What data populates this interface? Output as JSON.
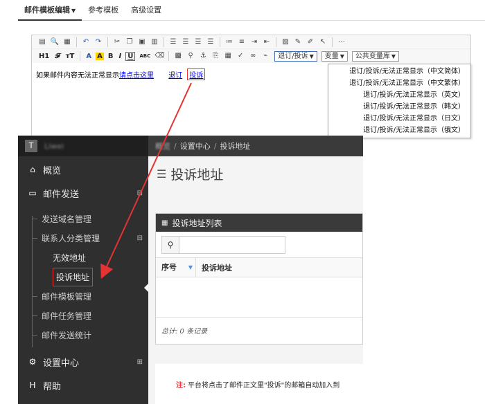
{
  "tabs": [
    {
      "label": "邮件模板编辑",
      "active": true
    },
    {
      "label": "参考模板",
      "active": false
    },
    {
      "label": "高级设置",
      "active": false
    }
  ],
  "toolbar": {
    "row2_text": [
      "H1",
      "𝓕",
      "тT",
      "A",
      "A",
      "B",
      "I",
      "U",
      "ABC"
    ],
    "drop_unsub": "退订/投诉",
    "drop_vars": "变量",
    "drop_public": "公共变量库"
  },
  "editor": {
    "text": "如果邮件内容无法正常显示",
    "link_view": "请点击这里",
    "link_unsub": "退订",
    "link_complain": "投诉"
  },
  "dropdown_items": [
    "退订/投诉/无法正常显示（中文简体）",
    "退订/投诉/无法正常显示（中文繁体）",
    "退订/投诉/无法正常显示（英文）",
    "退订/投诉/无法正常显示（韩文）",
    "退订/投诉/无法正常显示（日文）",
    "退订/投诉/无法正常显示（俄文）"
  ],
  "sidebar": {
    "brand": "Liwei",
    "overview": "概览",
    "mail_send": "邮件发送",
    "domain_mgmt": "发送域名管理",
    "contact_cat": "联系人分类管理",
    "invalid_addr": "无效地址",
    "complaint_addr": "投诉地址",
    "template_mgmt": "邮件模板管理",
    "task_mgmt": "邮件任务管理",
    "send_stats": "邮件发送统计",
    "settings": "设置中心",
    "help": "帮助"
  },
  "breadcrumb": {
    "home": "概览",
    "level1": "设置中心",
    "level2": "投诉地址"
  },
  "page": {
    "title": "投诉地址",
    "panel_title": "投诉地址列表",
    "col_no": "序号",
    "col_addr": "投诉地址",
    "footer": "总计: 0 条记录",
    "notice_label": "注:",
    "notice_text": "平台将点击了邮件正文里\"投诉\"的邮箱自动加入到"
  },
  "colors": {
    "annotation_red": "#e33333",
    "sidebar_bg": "#2f2f2f"
  }
}
